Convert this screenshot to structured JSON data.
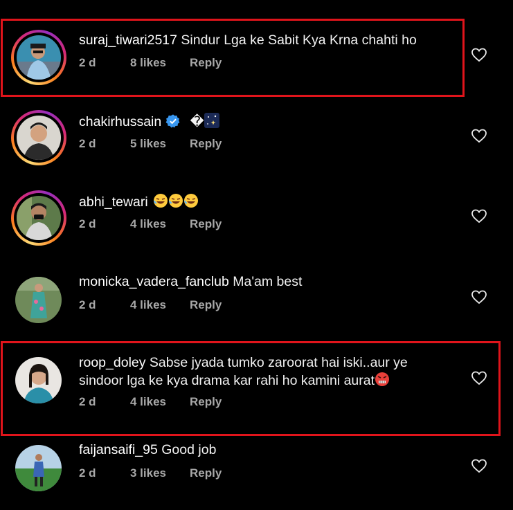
{
  "comments": [
    {
      "username": "suraj_tiwari2517",
      "text": "Sindur Lga ke Sabit Kya Krna chahti ho",
      "age": "2 d",
      "likes": "8 likes",
      "reply": "Reply",
      "story_ring": true,
      "highlighted": true
    },
    {
      "username": "chakirhussain",
      "text": "�",
      "age": "2 d",
      "likes": "5 likes",
      "reply": "Reply",
      "story_ring": true,
      "verified": true,
      "emoji": "sparkle-night-sky"
    },
    {
      "username": "abhi_tewari",
      "text": "",
      "age": "2 d",
      "likes": "4 likes",
      "reply": "Reply",
      "story_ring": true,
      "emoji": "rolling-on-floor-laughing x3"
    },
    {
      "username": "monicka_vadera_fanclub",
      "text": "Ma'am best",
      "age": "2 d",
      "likes": "4 likes",
      "reply": "Reply",
      "story_ring": false
    },
    {
      "username": "roop_doley",
      "text": "Sabse jyada tumko zaroorat hai iski..aur ye sindoor lga ke kya drama kar rahi ho kamini aurat",
      "age": "2 d",
      "likes": "4 likes",
      "reply": "Reply",
      "story_ring": false,
      "highlighted": true,
      "emoji": "enraged-face"
    },
    {
      "username": "faijansaifi_95",
      "text": "Good job",
      "age": "2 d",
      "likes": "3 likes",
      "reply": "Reply",
      "story_ring": false
    }
  ],
  "colors": {
    "background": "#000000",
    "text": "#ffffff",
    "meta": "#a8a8a8",
    "highlight_border": "#e0141b",
    "verified": "#3897f0"
  }
}
